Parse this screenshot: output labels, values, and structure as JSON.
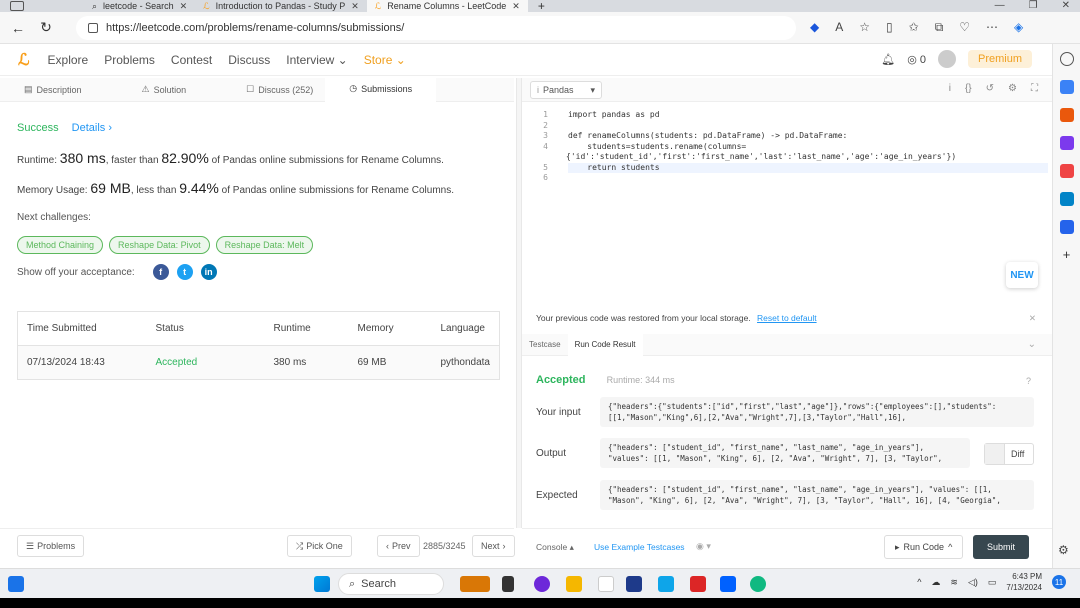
{
  "browser": {
    "tabs": [
      {
        "title": "leetcode - Search"
      },
      {
        "title": "Introduction to Pandas - Study P"
      },
      {
        "title": "Rename Columns - LeetCode"
      }
    ],
    "url": "https://leetcode.com/problems/rename-columns/submissions/"
  },
  "nav": {
    "items": [
      "Explore",
      "Problems",
      "Contest",
      "Discuss",
      "Interview",
      "Store"
    ],
    "coins": "0",
    "premium": "Premium"
  },
  "left_tabs": [
    "Description",
    "Solution",
    "Discuss (252)",
    "Submissions"
  ],
  "result_summary": {
    "status": "Success",
    "details": "Details",
    "runtime_prefix": "Runtime: ",
    "runtime_value": "380 ms",
    "runtime_mid": ", faster than ",
    "runtime_pct": "82.90%",
    "runtime_suffix": " of Pandas online submissions for Rename Columns.",
    "memory_prefix": "Memory Usage: ",
    "memory_value": "69 MB",
    "memory_mid": ", less than ",
    "memory_pct": "9.44%",
    "memory_suffix": " of Pandas online submissions for Rename Columns."
  },
  "next_challenges": {
    "label": "Next challenges:",
    "items": [
      "Method Chaining",
      "Reshape Data: Pivot",
      "Reshape Data: Melt"
    ]
  },
  "share": {
    "label": "Show off your acceptance:"
  },
  "submissions_table": {
    "headers": [
      "Time Submitted",
      "Status",
      "Runtime",
      "Memory",
      "Language"
    ],
    "rows": [
      [
        "07/13/2024 18:43",
        "Accepted",
        "380 ms",
        "69 MB",
        "pythondata"
      ]
    ]
  },
  "left_bottom": {
    "problems": "Problems",
    "pick_one": "Pick One",
    "prev": "Prev",
    "page": "2885/3245",
    "next": "Next"
  },
  "editor": {
    "language": "Pandas",
    "line_numbers": [
      "1",
      "2",
      "3",
      "4",
      "",
      "5",
      "6"
    ],
    "lines": [
      "import pandas as pd",
      "",
      "def renameColumns(students: pd.DataFrame) -> pd.DataFrame:",
      "    students=students.rename(columns=",
      "{'id':'student_id','first':'first_name','last':'last_name','age':'age_in_years'})",
      "    return students",
      ""
    ],
    "new_badge": "NEW"
  },
  "restore": {
    "message": "Your previous code was restored from your local storage.",
    "reset": "Reset to default"
  },
  "result_tabs": [
    "Testcase",
    "Run Code Result"
  ],
  "run_result": {
    "status": "Accepted",
    "runtime": "Runtime: 344 ms",
    "input_label": "Your input",
    "input": "{\"headers\":{\"students\":[\"id\",\"first\",\"last\",\"age\"]},\"rows\":{\"employees\":[],\"students\": [[1,\"Mason\",\"King\",6],[2,\"Ava\",\"Wright\",7],[3,\"Taylor\",\"Hall\",16],",
    "output_label": "Output",
    "output": "{\"headers\": [\"student_id\", \"first_name\", \"last_name\", \"age_in_years\"], \"values\": [[1, \"Mason\", \"King\", 6], [2, \"Ava\", \"Wright\", 7], [3, \"Taylor\",",
    "expected_label": "Expected",
    "expected": "{\"headers\": [\"student_id\", \"first_name\", \"last_name\", \"age_in_years\"], \"values\": [[1, \"Mason\", \"King\", 6], [2, \"Ava\", \"Wright\", 7], [3, \"Taylor\", \"Hall\", 16], [4, \"Georgia\",",
    "diff": "Diff"
  },
  "right_bottom": {
    "console": "Console",
    "use_example": "Use Example Testcases",
    "run_code": "Run Code",
    "submit": "Submit"
  },
  "taskbar": {
    "search": "Search",
    "time": "6:43 PM",
    "date": "7/13/2024",
    "notifications": "11"
  },
  "colors": {
    "accent_green": "#2db55d",
    "link_blue": "#2196f3",
    "brand_orange": "#f89f1b",
    "submit_dark": "#37474f"
  }
}
